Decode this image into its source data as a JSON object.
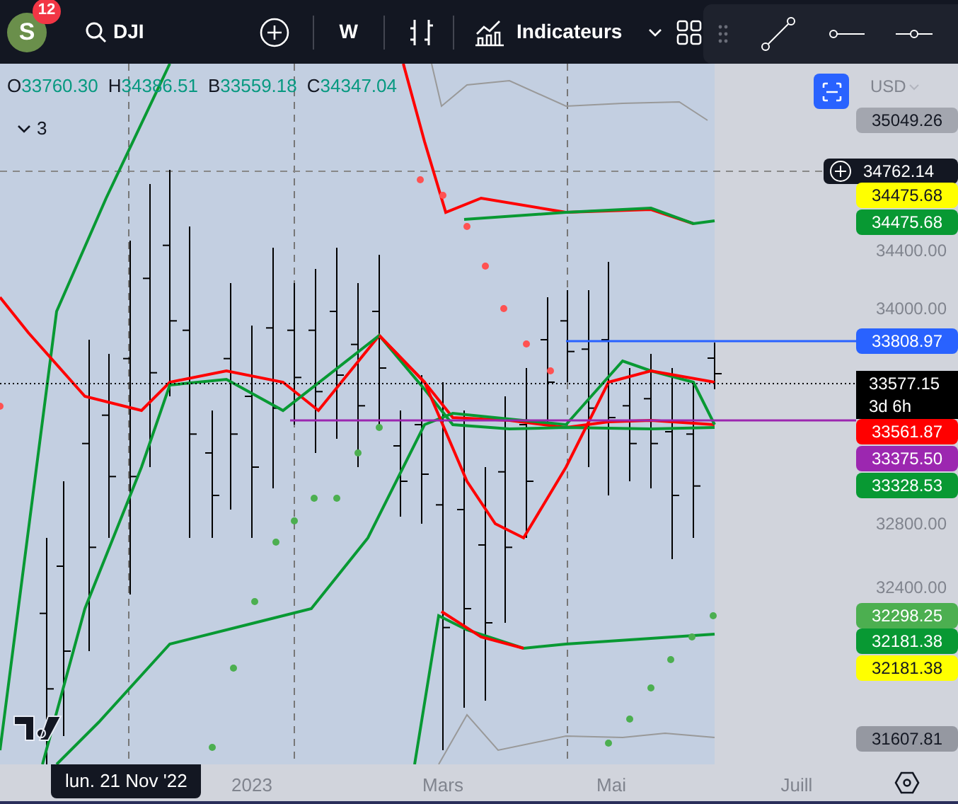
{
  "toolbar": {
    "avatar_letter": "S",
    "notification_count": "12",
    "symbol": "DJI",
    "interval": "W",
    "indicators_label": "Indicateurs"
  },
  "legend": [
    {
      "label": "O",
      "value": "33760.30"
    },
    {
      "label": "H",
      "value": "34386.51"
    },
    {
      "label": "B",
      "value": "33559.18"
    },
    {
      "label": "C",
      "value": "34347.04"
    }
  ],
  "indicators_toggle": {
    "count": "3",
    "expanded": false
  },
  "currency": "USD",
  "price_axis": [
    {
      "kind": "badge",
      "text": "35049.26",
      "color": "#a3a6af"
    },
    {
      "kind": "crosshair",
      "text": "34762.14",
      "color": "#131722"
    },
    {
      "kind": "badge",
      "text": "34475.68",
      "color": "#ffff00"
    },
    {
      "kind": "badge",
      "text": "34475.68",
      "color": "#089933"
    },
    {
      "kind": "tick",
      "text": "34400.00"
    },
    {
      "kind": "tick",
      "text": "34000.00"
    },
    {
      "kind": "badge",
      "text": "33808.97",
      "color": "#2962ff"
    },
    {
      "kind": "countdown",
      "text": "33577.15",
      "sub": "3d 6h",
      "color": "#000000"
    },
    {
      "kind": "badge",
      "text": "33561.87",
      "color": "#ff0000"
    },
    {
      "kind": "badge",
      "text": "33375.50",
      "color": "#9c27b0"
    },
    {
      "kind": "badge",
      "text": "33328.53",
      "color": "#089933"
    },
    {
      "kind": "tick",
      "text": "32800.00"
    },
    {
      "kind": "tick",
      "text": "32400.00"
    },
    {
      "kind": "badge",
      "text": "32298.25",
      "color": "#4caf50"
    },
    {
      "kind": "badge",
      "text": "32181.38",
      "color": "#089933"
    },
    {
      "kind": "badge",
      "text": "32181.38",
      "color": "#ffff00"
    },
    {
      "kind": "badge",
      "text": "31607.81",
      "color": "#9598a1"
    }
  ],
  "time_axis": [
    "2023",
    "Mars",
    "Mai",
    "Juill"
  ],
  "crosshair_date": "lun. 21 Nov '22"
}
